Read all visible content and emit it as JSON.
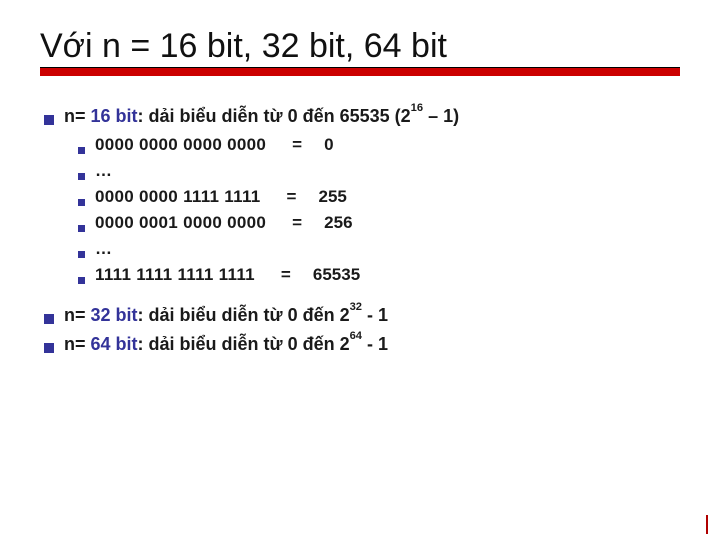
{
  "title": "Với n = 16 bit, 32 bit, 64 bit",
  "line_16": {
    "prefix": "n= ",
    "bits": "16 bit",
    "desc": ": dải biểu diễn từ 0 đến 65535 (2",
    "sup": "16",
    "tail": " – 1)"
  },
  "rows": {
    "r0": {
      "bin": "0000 0000 0000 0000",
      "eq": "=",
      "val": "0"
    },
    "r1": {
      "bin": "…"
    },
    "r2": {
      "bin": "0000 0000 1111 1111",
      "eq": "=",
      "val": "255"
    },
    "r3": {
      "bin": "0000 0001 0000 0000",
      "eq": "=",
      "val": "256"
    },
    "r4": {
      "bin": "…"
    },
    "r5": {
      "bin": "1111 1111 1111 1111",
      "eq": "=",
      "val": "65535"
    }
  },
  "line_32": {
    "prefix": "n= ",
    "bits": "32 bit",
    "desc": ": dải biểu diễn từ 0 đến 2",
    "sup": "32",
    "tail": " - 1"
  },
  "line_64": {
    "prefix": "n= ",
    "bits": "64 bit",
    "desc": ": dải biểu diễn từ 0 đến 2",
    "sup": "64",
    "tail": " - 1"
  }
}
